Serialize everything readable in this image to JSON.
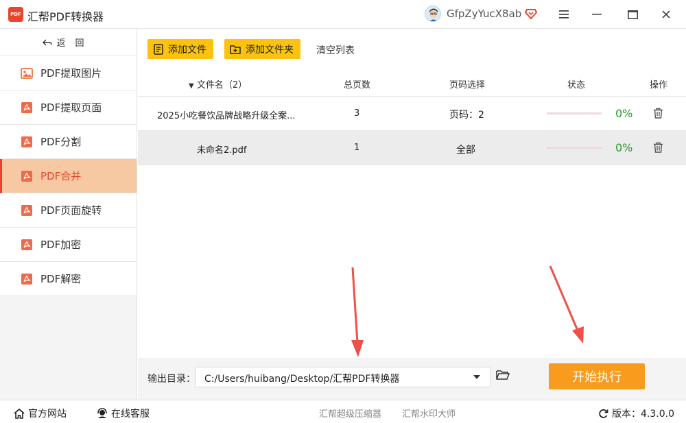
{
  "app": {
    "title": "汇帮PDF转换器",
    "logo_text": "PDF",
    "username": "GfpZyYucX8ab"
  },
  "sidebar": {
    "back_label": "返回",
    "items": [
      {
        "label": "PDF提取图片",
        "icon": "image-icon",
        "active": false
      },
      {
        "label": "PDF提取页面",
        "icon": "pdf-icon",
        "active": false
      },
      {
        "label": "PDF分割",
        "icon": "pdf-icon",
        "active": false
      },
      {
        "label": "PDF合并",
        "icon": "pdf-icon",
        "active": true
      },
      {
        "label": "PDF页面旋转",
        "icon": "pdf-icon",
        "active": false
      },
      {
        "label": "PDF加密",
        "icon": "pdf-icon",
        "active": false
      },
      {
        "label": "PDF解密",
        "icon": "pdf-icon",
        "active": false
      }
    ]
  },
  "toolbar": {
    "add_file": "添加文件",
    "add_folder": "添加文件夹",
    "clear_list": "清空列表"
  },
  "table": {
    "headers": {
      "filename": "文件名（2）",
      "pages": "总页数",
      "page_select": "页码选择",
      "status": "状态",
      "action": "操作"
    },
    "rows": [
      {
        "filename": "2025小吃餐饮品牌战略升级全案...",
        "pages": "3",
        "page_select": "页码：2",
        "progress": 0,
        "percent": "0%"
      },
      {
        "filename": "未命名2.pdf",
        "pages": "1",
        "page_select": "全部",
        "progress": 0,
        "percent": "0%"
      }
    ]
  },
  "output": {
    "label": "输出目录：",
    "path": "C:/Users/huibang/Desktop/汇帮PDF转换器",
    "start_button": "开始执行"
  },
  "statusbar": {
    "website": "官方网站",
    "support": "在线客服",
    "link1": "汇帮超级压缩器",
    "link2": "汇帮水印大师",
    "version": "版本：4.3.0.0"
  },
  "colors": {
    "accent": "#e8452c",
    "button_yellow": "#fbc30f",
    "start_orange": "#f99b1c",
    "active_bg": "#f6c9a2",
    "percent_green": "#2a9a2a"
  }
}
